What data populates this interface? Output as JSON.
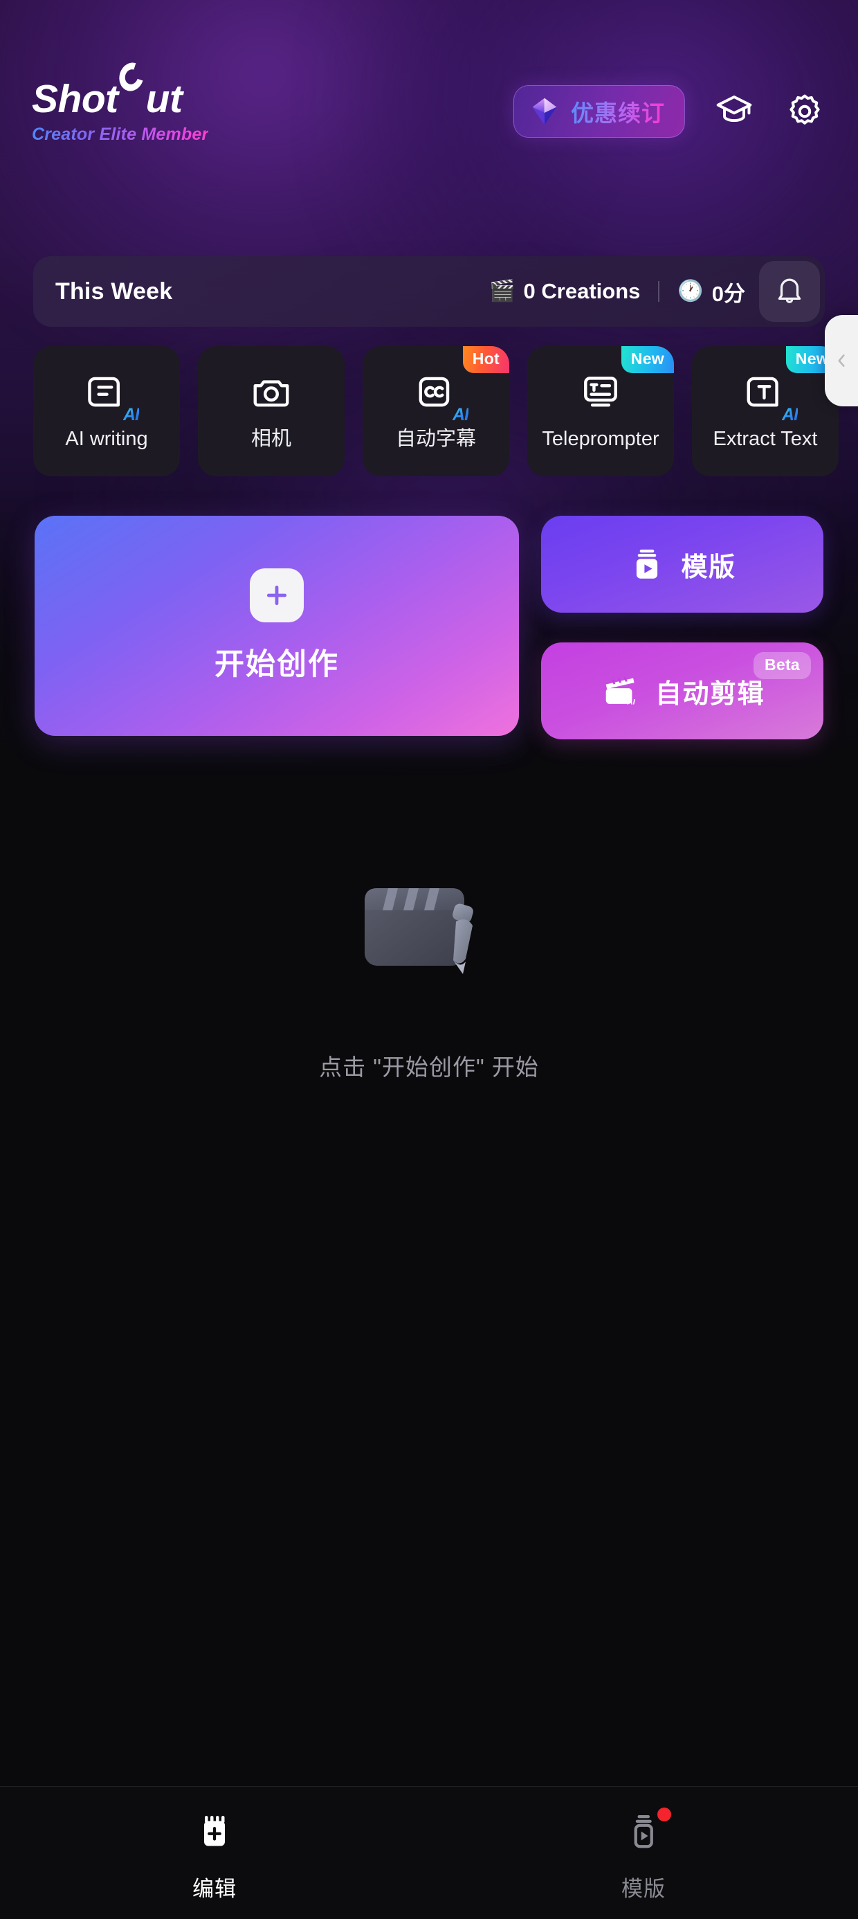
{
  "header": {
    "logo": "ShotCut",
    "logo_part1": "Shot",
    "logo_part2": "ut",
    "member_tier": "Creator Elite Member",
    "renew_button": "优惠续订",
    "gem_icon": "gem-icon",
    "graduation_icon": "graduation-cap-icon",
    "settings_icon": "gear-icon"
  },
  "week_bar": {
    "title": "This Week",
    "creations_emoji": "🎬",
    "creations": "0 Creations",
    "time_emoji": "🕐",
    "time": "0分",
    "bell_icon": "bell-icon"
  },
  "chips": [
    {
      "label": "AI writing",
      "icon": "document-ai-icon",
      "ai_tag": "AI",
      "badge": "",
      "badge_kind": ""
    },
    {
      "label": "相机",
      "icon": "camera-icon",
      "ai_tag": "",
      "badge": "",
      "badge_kind": ""
    },
    {
      "label": "自动字幕",
      "icon": "closed-caption-ai-icon",
      "ai_tag": "AI",
      "badge": "Hot",
      "badge_kind": "hot"
    },
    {
      "label": "Teleprompter",
      "icon": "teleprompter-icon",
      "ai_tag": "",
      "badge": "New",
      "badge_kind": "new"
    },
    {
      "label": "Extract Text",
      "icon": "text-extract-ai-icon",
      "ai_tag": "AI",
      "badge": "New",
      "badge_kind": "new"
    }
  ],
  "pull_tab": {
    "icon": "chevron-left-icon"
  },
  "actions": {
    "create": {
      "label": "开始创作",
      "icon": "plus-icon"
    },
    "template": {
      "label": "模版",
      "icon": "template-play-icon"
    },
    "auto_edit": {
      "label": "自动剪辑",
      "icon": "clapperboard-ai-icon",
      "badge": "Beta"
    }
  },
  "empty_state": {
    "illustration": "clapperboard-3d-illustration",
    "text": "点击 \"开始创作\" 开始"
  },
  "bottom_nav": [
    {
      "label": "编辑",
      "icon": "edit-add-icon",
      "active": true,
      "dot": false
    },
    {
      "label": "模版",
      "icon": "template-play-icon",
      "active": false,
      "dot": true
    }
  ],
  "colors": {
    "background": "#0a0a0c",
    "header_purple": "#2b1145",
    "accent_blue": "#5a73f6",
    "accent_pink": "#ef72dd",
    "accent_violet": "#7b45ef",
    "badge_hot": "#ff5a35",
    "badge_new": "#1fb9ef",
    "red_dot": "#f5232c"
  }
}
